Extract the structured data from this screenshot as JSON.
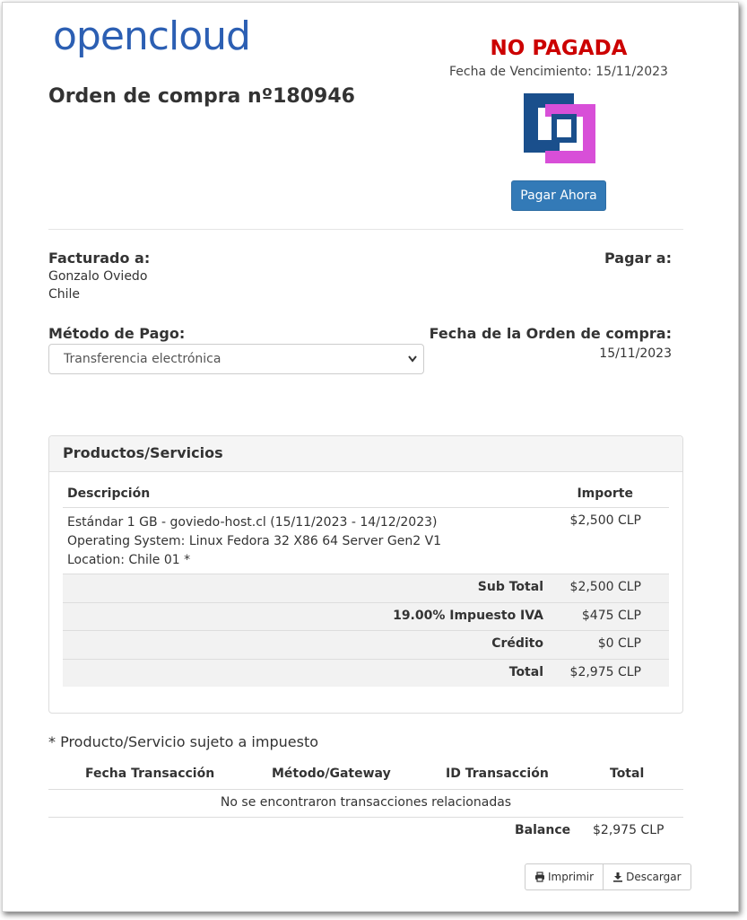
{
  "header": {
    "logo_text": "opencloud",
    "order_title": "Orden de compra nº180946",
    "status": "NO PAGADA",
    "due_date_label": "Fecha de Vencimiento: 15/11/2023",
    "pay_button": "Pagar Ahora"
  },
  "billing": {
    "billed_to_title": "Facturado a:",
    "name": "Gonzalo Oviedo",
    "country": "Chile",
    "pay_to_title": "Pagar a:"
  },
  "payment": {
    "method_title": "Método de Pago:",
    "method_value": "Transferencia electrónica",
    "order_date_title": "Fecha de la Orden de compra:",
    "order_date": "15/11/2023"
  },
  "products": {
    "panel_title": "Productos/Servicios",
    "col_description": "Descripción",
    "col_amount": "Importe",
    "items": [
      {
        "line1": "Estándar 1 GB - goviedo-host.cl (15/11/2023 - 14/12/2023)",
        "line2": "Operating System: Linux Fedora 32 X86 64 Server Gen2 V1",
        "line3": "Location: Chile 01 *",
        "amount": "$2,500 CLP"
      }
    ],
    "summary": [
      {
        "label": "Sub Total",
        "value": "$2,500 CLP"
      },
      {
        "label": "19.00% Impuesto IVA",
        "value": "$475 CLP"
      },
      {
        "label": "Crédito",
        "value": "$0 CLP"
      },
      {
        "label": "Total",
        "value": "$2,975 CLP"
      }
    ]
  },
  "tax_note": "* Producto/Servicio sujeto a impuesto",
  "transactions": {
    "col_date": "Fecha Transacción",
    "col_method": "Método/Gateway",
    "col_id": "ID Transacción",
    "col_total": "Total",
    "empty_message": "No se encontraron transacciones relacionadas",
    "balance_label": "Balance",
    "balance_value": "$2,975 CLP"
  },
  "actions": {
    "print": "Imprimir",
    "download": "Descargar"
  },
  "colors": {
    "brand_blue": "#2c5fb3",
    "status_red": "#cc0000",
    "button_blue": "#337ab7",
    "logo_dark_blue": "#1a4f8c",
    "logo_magenta": "#d84fd8"
  },
  "icons": [
    "opencloud-logo",
    "brand-square-logo",
    "chevron-down-icon",
    "print-icon",
    "download-icon"
  ]
}
